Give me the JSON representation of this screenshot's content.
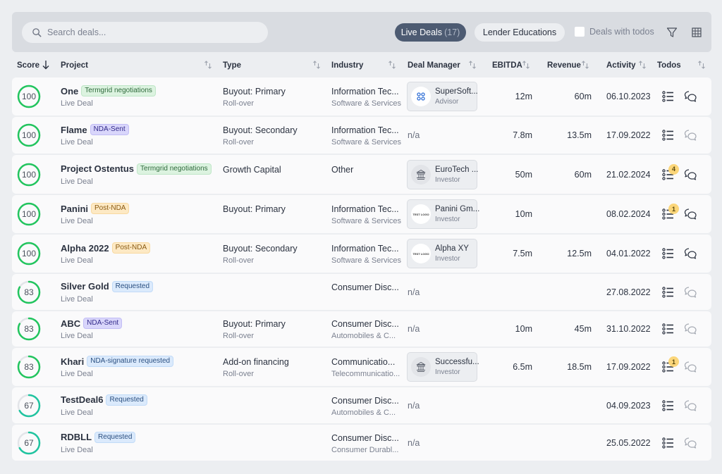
{
  "toolbar": {
    "search_placeholder": "Search deals...",
    "tabs": [
      {
        "label": "Live Deals",
        "count": "(17)",
        "active": true
      },
      {
        "label": "Lender Educations",
        "active": false
      }
    ],
    "todos_checkbox_label": "Deals with todos",
    "todos_checkbox_checked": false,
    "icons": [
      "search-icon",
      "filter-icon",
      "grid-icon"
    ]
  },
  "columns": {
    "score": "Score",
    "project": "Project",
    "type": "Type",
    "industry": "Industry",
    "deal_manager": "Deal Manager",
    "ebitda": "EBITDA",
    "revenue": "Revenue",
    "activity": "Activity",
    "todos": "Todos"
  },
  "colors": {
    "score_green": "#22c55e",
    "score_teal": "#20c4a0",
    "badge_green_bg": "#dcf3e0",
    "badge_purple_bg": "#d9d6fb",
    "badge_orange_bg": "#fde9c4",
    "badge_blue_bg": "#dbeafc",
    "todo_badge": "#fbd67a",
    "active_tab": "#4d5b72"
  },
  "rows": [
    {
      "score": 100,
      "name": "One",
      "badge": "Termgrid negotiations",
      "badge_type": "green",
      "status": "Live Deal",
      "type": "Buyout: Primary",
      "type_sub": "Roll-over",
      "industry": "Information Tec...",
      "industry_sub": "Software & Services",
      "manager": {
        "name": "SuperSoft...",
        "role": "Advisor",
        "logo": "supersoft-logo"
      },
      "ebitda": "12m",
      "revenue": "60m",
      "activity": "06.10.2023",
      "todo_count": "",
      "chat_active": true
    },
    {
      "score": 100,
      "name": "Flame",
      "badge": "NDA-Sent",
      "badge_type": "purple",
      "status": "Live Deal",
      "type": "Buyout: Secondary",
      "type_sub": "Roll-over",
      "industry": "Information Tec...",
      "industry_sub": "Software & Services",
      "manager": null,
      "manager_na": "n/a",
      "ebitda": "7.8m",
      "revenue": "13.5m",
      "activity": "17.09.2022",
      "todo_count": "",
      "chat_active": false
    },
    {
      "score": 100,
      "name": "Project Ostentus",
      "badge": "Termgrid negotiations",
      "badge_type": "green",
      "status": "Live Deal",
      "type": "Growth Capital",
      "type_sub": "",
      "industry": "Other",
      "industry_sub": "",
      "manager": {
        "name": "EuroTech ...",
        "role": "Investor",
        "logo": "bank-logo"
      },
      "ebitda": "50m",
      "revenue": "60m",
      "activity": "21.02.2024",
      "todo_count": "4",
      "chat_active": true
    },
    {
      "score": 100,
      "name": "Panini",
      "badge": "Post-NDA",
      "badge_type": "orange",
      "status": "Live Deal",
      "type": "Buyout: Primary",
      "type_sub": "",
      "industry": "Information Tec...",
      "industry_sub": "Software & Services",
      "manager": {
        "name": "Panini Gm...",
        "role": "Investor",
        "logo": "test-logo"
      },
      "ebitda": "10m",
      "revenue": "",
      "activity": "08.02.2024",
      "todo_count": "1",
      "chat_active": true
    },
    {
      "score": 100,
      "name": "Alpha 2022",
      "badge": "Post-NDA",
      "badge_type": "orange",
      "status": "Live Deal",
      "type": "Buyout: Secondary",
      "type_sub": "Roll-over",
      "industry": "Information Tec...",
      "industry_sub": "Software & Services",
      "manager": {
        "name": "Alpha XY",
        "role": "Investor",
        "logo": "test-logo"
      },
      "ebitda": "7.5m",
      "revenue": "12.5m",
      "activity": "04.01.2022",
      "todo_count": "",
      "chat_active": true
    },
    {
      "score": 83,
      "name": "Silver Gold",
      "badge": "Requested",
      "badge_type": "blue",
      "status": "Live Deal",
      "type": "",
      "type_sub": "",
      "industry": "Consumer Disc...",
      "industry_sub": "",
      "manager": null,
      "manager_na": "n/a",
      "ebitda": "",
      "revenue": "",
      "activity": "27.08.2022",
      "todo_count": "",
      "chat_active": false
    },
    {
      "score": 83,
      "name": "ABC",
      "badge": "NDA-Sent",
      "badge_type": "purple",
      "status": "Live Deal",
      "type": "Buyout: Primary",
      "type_sub": "Roll-over",
      "industry": "Consumer Disc...",
      "industry_sub": "Automobiles & C...",
      "manager": null,
      "manager_na": "n/a",
      "ebitda": "10m",
      "revenue": "45m",
      "activity": "31.10.2022",
      "todo_count": "",
      "chat_active": false
    },
    {
      "score": 83,
      "name": "Khari",
      "badge": "NDA-signature requested",
      "badge_type": "blue",
      "status": "Live Deal",
      "type": "Add-on financing",
      "type_sub": "Roll-over",
      "industry": "Communicatio...",
      "industry_sub": "Telecommunicatio...",
      "manager": {
        "name": "Successfu...",
        "role": "Investor",
        "logo": "bank-logo"
      },
      "ebitda": "6.5m",
      "revenue": "18.5m",
      "activity": "17.09.2022",
      "todo_count": "1",
      "chat_active": false
    },
    {
      "score": 67,
      "name": "TestDeal6",
      "badge": "Requested",
      "badge_type": "blue",
      "status": "Live Deal",
      "type": "",
      "type_sub": "",
      "industry": "Consumer Disc...",
      "industry_sub": "Automobiles & C...",
      "manager": null,
      "manager_na": "n/a",
      "ebitda": "",
      "revenue": "",
      "activity": "04.09.2023",
      "todo_count": "",
      "chat_active": false
    },
    {
      "score": 67,
      "name": "RDBLL",
      "badge": "Requested",
      "badge_type": "blue",
      "status": "Live Deal",
      "type": "",
      "type_sub": "",
      "industry": "Consumer Disc...",
      "industry_sub": "Consumer Durabl...",
      "manager": null,
      "manager_na": "n/a",
      "ebitda": "",
      "revenue": "",
      "activity": "25.05.2022",
      "todo_count": "",
      "chat_active": false
    }
  ],
  "test_logo_text": "TEST LOGO"
}
